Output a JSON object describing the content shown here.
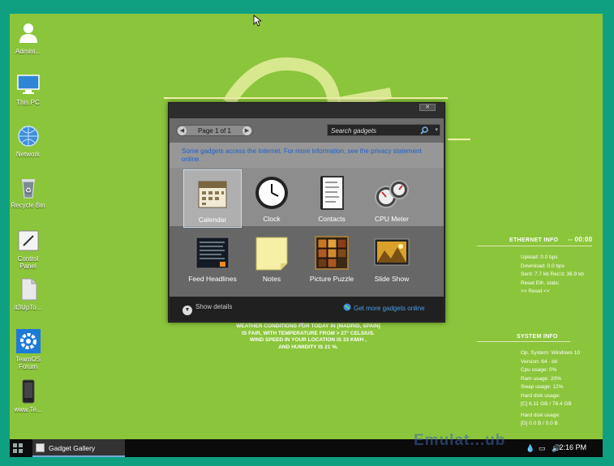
{
  "desktop": {
    "icons": [
      {
        "label": "Admini..."
      },
      {
        "label": "This PC"
      },
      {
        "label": "Network"
      },
      {
        "label": "Recycle Bin"
      },
      {
        "label": "Control Panel"
      },
      {
        "label": "it3UpTo..."
      },
      {
        "label": "TeamOS Forum"
      },
      {
        "label": "www.Te..."
      }
    ]
  },
  "ethernet": {
    "title": "ETHERNET INFO",
    "time": "-- 00:00",
    "lines": [
      "Upload: 0.0 bps",
      "Download: 0.0 bps",
      "Sent: 7.7 kb  Rec'd: 36.9 kb",
      "Reset Eth. stats:",
      ">> Reset <<"
    ]
  },
  "system": {
    "title": "SYSTEM INFO",
    "lines": [
      "Op. System: Windows 10",
      "Version: 64 - bit",
      "Cpu usage: 0%",
      "Ram usage: 20%",
      "Swap usage: 12%",
      "Hard disk usage:",
      "[C] 6.11 GB / 78.4 GB",
      "Hard disk usage:",
      "[D] 0.0 B / 0.0 B"
    ]
  },
  "weather": {
    "lines": [
      "WEATHER CONDITIONS FOR TODAY IN [MADRID, SPAIN]",
      "IS FAIR, WITH TEMPERATURE FROM > 27° CELSIUS.",
      "WIND SPEED IN YOUR LOCATION IS 33 KM/H ,",
      "AND HUMIDITY IS 21 %."
    ]
  },
  "gallery": {
    "page_label": "Page 1 of 1",
    "search_placeholder": "Search gadgets",
    "info_text": "Some gadgets access the Internet.  For more information, see the privacy statement online.",
    "gadgets": [
      {
        "label": "Calendar"
      },
      {
        "label": "Clock"
      },
      {
        "label": "Contacts"
      },
      {
        "label": "CPU Meter"
      },
      {
        "label": "Feed Headlines"
      },
      {
        "label": "Notes"
      },
      {
        "label": "Picture Puzzle"
      },
      {
        "label": "Slide Show"
      }
    ],
    "show_details": "Show details",
    "get_more": "Get more gadgets online"
  },
  "taskbar": {
    "item_label": "Gadget Gallery",
    "clock": "2:16 PM"
  },
  "watermark": "Emulat...ub"
}
